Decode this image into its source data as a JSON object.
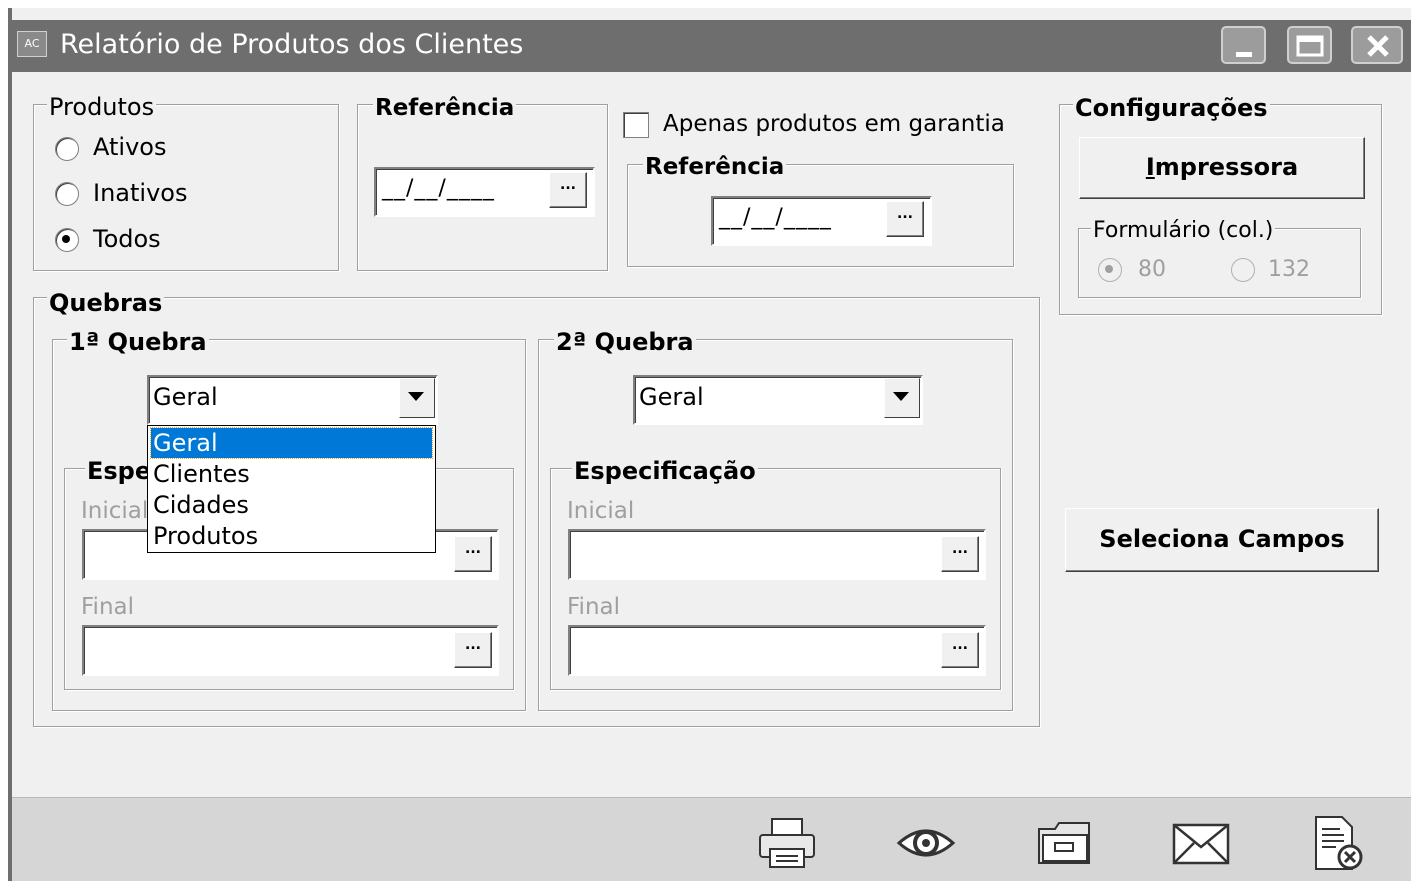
{
  "window": {
    "title": "Relatório de Produtos dos Clientes",
    "app_icon_text": "AC"
  },
  "produtos": {
    "legend": "Produtos",
    "options": [
      "Ativos",
      "Inativos",
      "Todos"
    ],
    "selected": "Todos"
  },
  "referencia1": {
    "legend": "Referência",
    "mask": "__/__/____",
    "lookup_label": "..."
  },
  "garantia": {
    "label": "Apenas produtos em garantia",
    "checked": false
  },
  "referencia2": {
    "legend": "Referência",
    "mask": "__/__/____",
    "lookup_label": "..."
  },
  "configuracoes": {
    "legend": "Configurações",
    "printer_button_prefix": "I",
    "printer_button_rest": "mpressora",
    "formulario": {
      "legend": "Formulário (col.)",
      "options": [
        "80",
        "132"
      ],
      "selected": "80",
      "enabled": false
    }
  },
  "quebras": {
    "legend": "Quebras",
    "q1": {
      "legend": "1ª Quebra",
      "selected": "Geral",
      "spec_legend_partial": "Espe",
      "inicial_label": "Inicial",
      "final_label": "Final",
      "dropdown_open": true,
      "options": [
        "Geral",
        "Clientes",
        "Cidades",
        "Produtos"
      ]
    },
    "q2": {
      "legend": "2ª Quebra",
      "selected": "Geral",
      "spec_legend": "Especificação",
      "inicial_label": "Inicial",
      "final_label": "Final"
    }
  },
  "seleciona_campos": "Seleciona Campos",
  "lookup_label": "...",
  "toolbar": [
    "printer-icon",
    "preview-eye-icon",
    "folder-icon",
    "email-icon",
    "close-report-icon"
  ]
}
